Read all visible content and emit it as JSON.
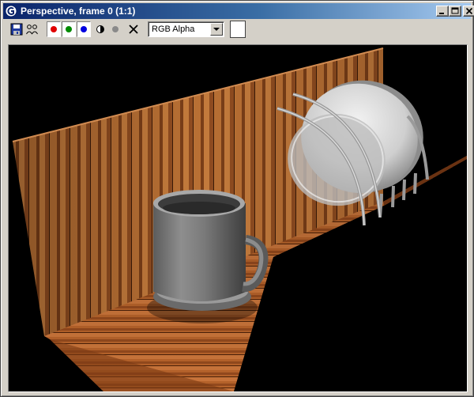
{
  "window": {
    "title": "Perspective, frame 0 (1:1)"
  },
  "titlebar_buttons": {
    "minimize": "minimize",
    "maximize": "maximize",
    "close": "close"
  },
  "toolbar": {
    "tools": [
      {
        "name": "save-icon"
      },
      {
        "name": "clone-icon"
      }
    ],
    "channels": [
      {
        "name": "red-channel",
        "color": "#e00000"
      },
      {
        "name": "green-channel",
        "color": "#008a00"
      },
      {
        "name": "blue-channel",
        "color": "#0000e0"
      }
    ],
    "extra_icons": [
      {
        "name": "monochrome-icon"
      },
      {
        "name": "alpha-dot-icon"
      },
      {
        "name": "clear-icon"
      }
    ],
    "channel_select": {
      "value": "RGB Alpha"
    },
    "swatch_color": "#ffffff"
  },
  "render": {
    "background": "#000000",
    "scene": [
      "wooden wall panel",
      "wooden floor panel",
      "gray mug",
      "white plate in wire rack"
    ]
  }
}
